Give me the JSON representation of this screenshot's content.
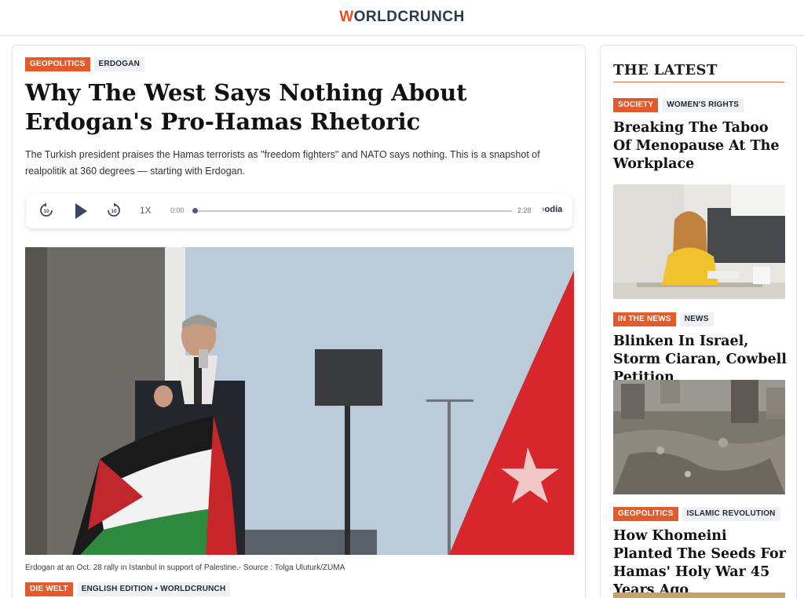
{
  "site": {
    "logo_prefix": "W",
    "logo_rest": "ORLDCRUNCH"
  },
  "article": {
    "tags": [
      {
        "label": "GEOPOLITICS"
      },
      {
        "label": "ERDOGAN"
      }
    ],
    "title": "Why The West Says Nothing About Erdogan's Pro-Hamas Rhetoric",
    "dek": "The Turkish president praises the Hamas terrorists as \"freedom fighters\" and NATO says nothing. This is a snapshot of realpolitik at 360 degrees — starting with Erdogan.",
    "caption": "Erdogan at an Oct. 28 rally in Istanbul in support of Palestine.- Source : Tolga Uluturk/ZUMA",
    "source_tags": [
      {
        "label": "DIE WELT"
      },
      {
        "label": "ENGLISH EDITION • WORLDCRUNCH"
      }
    ]
  },
  "player": {
    "speed": "1X",
    "current_time": "0:00",
    "total_time": "2:28",
    "progress": 0.0,
    "brand": "odia",
    "skip_back_label": "10",
    "skip_forward_label": "10"
  },
  "sidebar": {
    "heading": "THE LATEST",
    "items": [
      {
        "tags": [
          {
            "label": "SOCIETY"
          },
          {
            "label": "WOMEN'S RIGHTS"
          }
        ],
        "title": "Breaking The Taboo Of Menopause At The Workplace"
      },
      {
        "tags": [
          {
            "label": "IN THE NEWS"
          },
          {
            "label": "NEWS"
          }
        ],
        "title": "Blinken In Israel, Storm Ciaran, Cowbell Petition"
      },
      {
        "tags": [
          {
            "label": "GEOPOLITICS"
          },
          {
            "label": "ISLAMIC REVOLUTION"
          }
        ],
        "title": "How Khomeini Planted The Seeds For Hamas' Holy War 45 Years Ago"
      }
    ]
  },
  "colors": {
    "accent": "#e45a2b",
    "tag_secondary_bg": "#eff1f4",
    "logo_text": "#2b3a4a"
  },
  "icons": {
    "skip_back": "rewind-10-icon",
    "play": "play-icon",
    "skip_forward": "forward-10-icon"
  }
}
